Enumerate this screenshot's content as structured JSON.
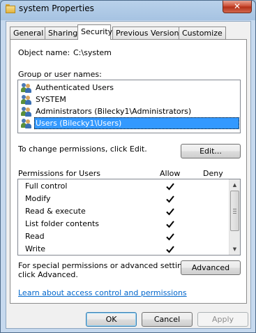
{
  "window": {
    "title": "system Properties",
    "close_symbol": "✕"
  },
  "tabs": [
    {
      "label": "General"
    },
    {
      "label": "Sharing"
    },
    {
      "label": "Security"
    },
    {
      "label": "Previous Versions"
    },
    {
      "label": "Customize"
    }
  ],
  "security": {
    "object_name_label": "Object name:",
    "object_name_value": "C:\\system",
    "group_label": "Group or user names:",
    "groups": [
      {
        "label": "Authenticated Users",
        "icon": "users-icon"
      },
      {
        "label": "SYSTEM",
        "icon": "users-icon"
      },
      {
        "label": "Administrators (Bilecky1\\Administrators)",
        "icon": "users-icon"
      },
      {
        "label": "Users (Bilecky1\\Users)",
        "icon": "users-icon",
        "selected": true
      }
    ],
    "change_text": "To change permissions, click Edit.",
    "edit_button": "Edit...",
    "permissions_label": "Permissions for Users",
    "allow_header": "Allow",
    "deny_header": "Deny",
    "permissions": [
      {
        "label": "Full control",
        "allow": true,
        "deny": false
      },
      {
        "label": "Modify",
        "allow": true,
        "deny": false
      },
      {
        "label": "Read & execute",
        "allow": true,
        "deny": false
      },
      {
        "label": "List folder contents",
        "allow": true,
        "deny": false
      },
      {
        "label": "Read",
        "allow": true,
        "deny": false
      },
      {
        "label": "Write",
        "allow": true,
        "deny": false
      }
    ],
    "advanced_text_1": "For special permissions or advanced settings,",
    "advanced_text_2": "click Advanced.",
    "advanced_button": "Advanced",
    "learn_link": "Learn about access control and permissions"
  },
  "footer": {
    "ok": "OK",
    "cancel": "Cancel",
    "apply": "Apply"
  },
  "colors": {
    "selection": "#3399ff",
    "link": "#0066cc"
  }
}
